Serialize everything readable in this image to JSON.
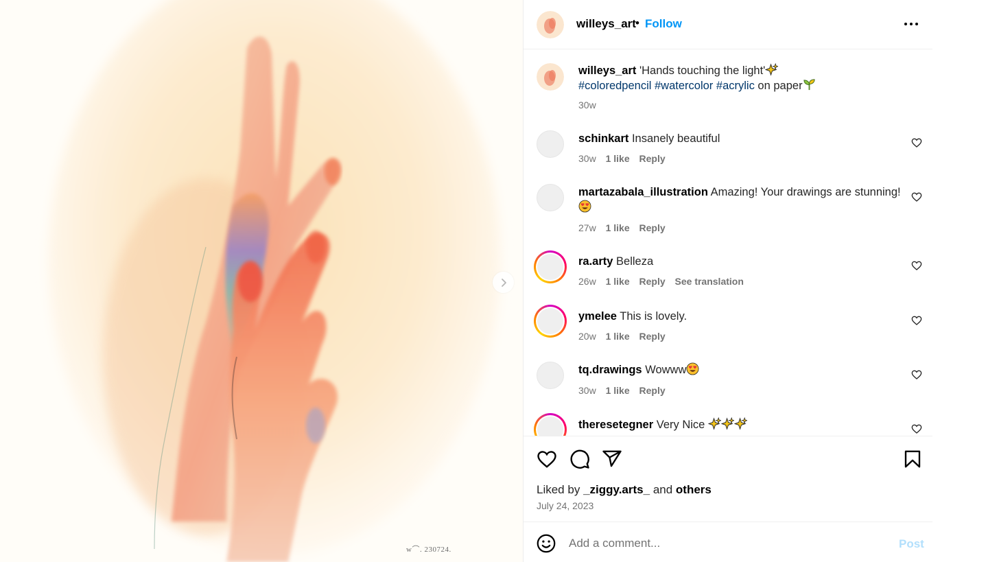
{
  "post": {
    "username": "willeys_art",
    "separator": "•",
    "follow_label": "Follow"
  },
  "artwork": {
    "signature": "w⌒. 230724."
  },
  "caption": {
    "username": "willeys_art",
    "text": "'Hands touching the light'",
    "hashtags": [
      "#coloredpencil",
      "#watercolor",
      "#acrylic"
    ],
    "suffix": "on paper",
    "time": "30w"
  },
  "comments": [
    {
      "username": "schinkart",
      "text": "Insanely beautiful",
      "time": "30w",
      "likes": "1 like",
      "reply": "Reply",
      "ring": false
    },
    {
      "username": "martazabala_illustration",
      "text": "Amazing! Your drawings are stunning!",
      "time": "27w",
      "likes": "1 like",
      "reply": "Reply",
      "ring": false
    },
    {
      "username": "ra.arty",
      "text": "Belleza",
      "time": "26w",
      "likes": "1 like",
      "reply": "Reply",
      "extra": "See translation",
      "ring": true
    },
    {
      "username": "ymelee",
      "text": "This is lovely.",
      "time": "20w",
      "likes": "1 like",
      "reply": "Reply",
      "ring": true
    },
    {
      "username": "tq.drawings",
      "text": "Wowww",
      "time": "30w",
      "likes": "1 like",
      "reply": "Reply",
      "ring": false
    },
    {
      "username": "theresetegner",
      "text": "Very Nice",
      "ring": true
    }
  ],
  "likes_line": {
    "prefix": "Liked by",
    "user": "_ziggy.arts_",
    "and": "and",
    "others": "others"
  },
  "date": "July 24, 2023",
  "add_comment": {
    "placeholder": "Add a comment...",
    "post_label": "Post"
  },
  "colors": {
    "follow": "#0095f6",
    "hashtag": "#00376b",
    "muted": "#737373",
    "post_disabled": "#b2dffc"
  },
  "icons": [
    "chevron-right-icon",
    "more-icon",
    "heart-icon",
    "comment-icon",
    "share-icon",
    "bookmark-icon",
    "smiley-icon",
    "sparkles-emoji",
    "seedling-emoji",
    "heart-eyes-emoji"
  ]
}
